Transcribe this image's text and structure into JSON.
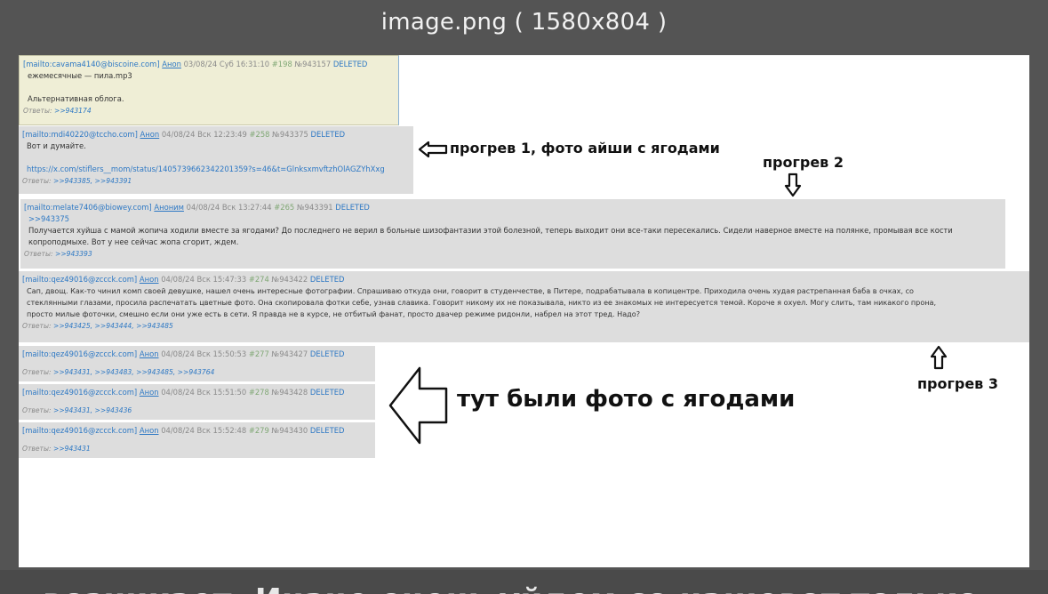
{
  "viewer": {
    "title": "image.png ( 1580x804 )"
  },
  "bottom_text": "возникает. Иначе очень уйдем со нашевот только",
  "posts": [
    {
      "mail": "[mailto:cavama4140@biscoine.com]",
      "name": "Аноn",
      "date": "03/08/24 Суб 16:31:10",
      "num": "#198",
      "postno": "№943157",
      "deleted": "DELETED",
      "lines": [
        "ежемесячные — пила.mp3",
        "",
        "Альтернативная облога."
      ],
      "replies_label": "Ответы:",
      "replies": [
        ">>943174"
      ]
    },
    {
      "mail": "[mailto:mdi40220@tccho.com]",
      "name": "Аноn",
      "date": "04/08/24 Вск 12:23:49",
      "num": "#258",
      "postno": "№943375",
      "deleted": "DELETED",
      "lines": [
        "Вот и думайте.",
        "",
        "https://x.com/stiflers__mom/status/1405739662342201359?s=46&t=GlnksxmvftzhOlAGZYhXxg"
      ],
      "replies_label": "Ответы:",
      "replies": [
        ">>943385,",
        ">>943391"
      ]
    },
    {
      "mail": "[mailto:melate7406@biowey.com]",
      "name": "Аноним",
      "date": "04/08/24 Вск 13:27:44",
      "num": "#265",
      "postno": "№943391",
      "deleted": "DELETED",
      "quote": ">>943375",
      "lines": [
        "Получается хуйша с мамой жопича ходили вместе за ягодами? До последнего не верил в больные шизофантазии этой болезной, теперь выходит они все-таки пересекались. Сидели наверное вместе на полянке, промывая все кости",
        "копроподмыхе. Вот у нее сейчас жопа сгорит, ждем."
      ],
      "replies_label": "Ответы:",
      "replies": [
        ">>943393"
      ]
    },
    {
      "mail": "[mailto:qez49016@zccck.com]",
      "name": "Аноn",
      "date": "04/08/24 Вск 15:47:33",
      "num": "#274",
      "postno": "№943422",
      "deleted": "DELETED",
      "lines": [
        "Сап, двощ. Как-то чинил комп своей девушке, нашел очень интересные фотографии. Спрашиваю откуда они, говорит в студенчестве, в Питере, подрабатывала в копицентре. Приходила очень худая растрепанная баба в очках, со",
        "стеклянными глазами, просила распечатать цветные фото. Она скопировала фотки себе, узнав славика. Говорит никому их не показывала, никто из ее знакомых не интересуется темой. Короче я охуел. Могу слить, там никакого прона,",
        "просто милые фоточки, смешно если они уже есть в сети. Я правда не в курсе, не отбитый фанат, просто двачер режиме ридонли, набрел на этот тред. Надо?"
      ],
      "replies_label": "Ответы:",
      "replies": [
        ">>943425,",
        ">>943444,",
        ">>943485"
      ]
    },
    {
      "mail": "[mailto:qez49016@zccck.com]",
      "name": "Аноn",
      "date": "04/08/24 Вск 15:50:53",
      "num": "#277",
      "postno": "№943427",
      "deleted": "DELETED",
      "lines": [],
      "replies_label": "Ответы:",
      "replies": [
        ">>943431,",
        ">>943483,",
        ">>943485,",
        ">>943764"
      ]
    },
    {
      "mail": "[mailto:qez49016@zccck.com]",
      "name": "Аноn",
      "date": "04/08/24 Вск 15:51:50",
      "num": "#278",
      "postno": "№943428",
      "deleted": "DELETED",
      "lines": [],
      "replies_label": "Ответы:",
      "replies": [
        ">>943431,",
        ">>943436"
      ]
    },
    {
      "mail": "[mailto:qez49016@zccck.com]",
      "name": "Аноn",
      "date": "04/08/24 Вск 15:52:48",
      "num": "#279",
      "postno": "№943430",
      "deleted": "DELETED",
      "lines": [],
      "replies_label": "Ответы:",
      "replies": [
        ">>943431"
      ]
    }
  ],
  "annotations": {
    "a1": "прогрев 1, фото айши с ягодами",
    "a2": "прогрев 2",
    "a3": "прогрев 3",
    "a4": "тут были фото с ягодами"
  },
  "colors": {
    "link": "#2d78c4",
    "post_bg": "#dddddd",
    "op_bg": "#efeed6",
    "viewer_bg": "#545454"
  }
}
